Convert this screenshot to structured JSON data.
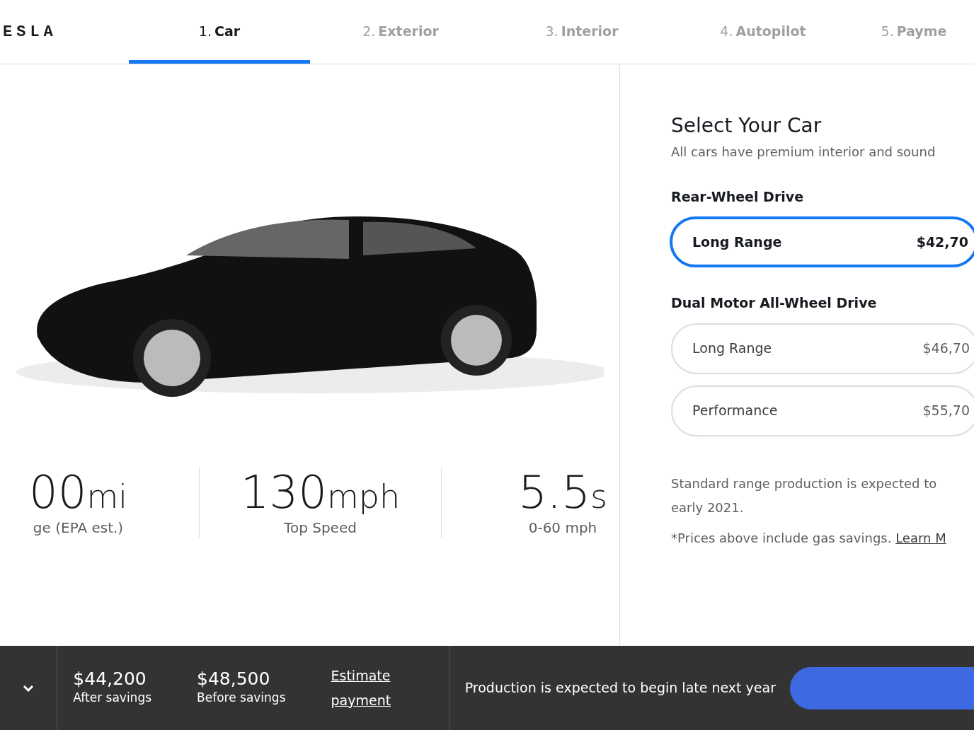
{
  "header": {
    "logo": "ESLA",
    "tabs": [
      {
        "number": "1.",
        "label": "Car",
        "selected": true
      },
      {
        "number": "2.",
        "label": "Exterior",
        "selected": false
      },
      {
        "number": "3.",
        "label": "Interior",
        "selected": false
      },
      {
        "number": "4.",
        "label": "Autopilot",
        "selected": false
      },
      {
        "number": "5.",
        "label": "Payme",
        "selected": false
      }
    ]
  },
  "stats": [
    {
      "value": "00",
      "unit": "mi",
      "label": "ge (EPA est.)"
    },
    {
      "value": "130",
      "unit": "mph",
      "label": "Top Speed"
    },
    {
      "value": "5.5",
      "unit": "s",
      "label": "0-60 mph"
    }
  ],
  "panel": {
    "title": "Select Your Car",
    "subtitle": "All cars have premium interior and sound",
    "groups": [
      {
        "heading": "Rear-Wheel Drive",
        "options": [
          {
            "name": "Long Range",
            "price": "$42,70",
            "selected": true
          }
        ]
      },
      {
        "heading": "Dual Motor All-Wheel Drive",
        "options": [
          {
            "name": "Long Range",
            "price": "$46,70",
            "selected": false
          },
          {
            "name": "Performance",
            "price": "$55,70",
            "selected": false
          }
        ]
      }
    ],
    "note": "Standard range production is expected to\nearly 2021.",
    "footnote": "*Prices above include gas savings.",
    "link": "Learn M"
  },
  "footer": {
    "expanded": false,
    "prices": [
      {
        "amount": "$44,200",
        "label": "After savings"
      },
      {
        "amount": "$48,500",
        "label": "Before savings"
      }
    ],
    "estimate_link": "Estimate\npayment",
    "message": "Production is expected to begin late next year"
  }
}
